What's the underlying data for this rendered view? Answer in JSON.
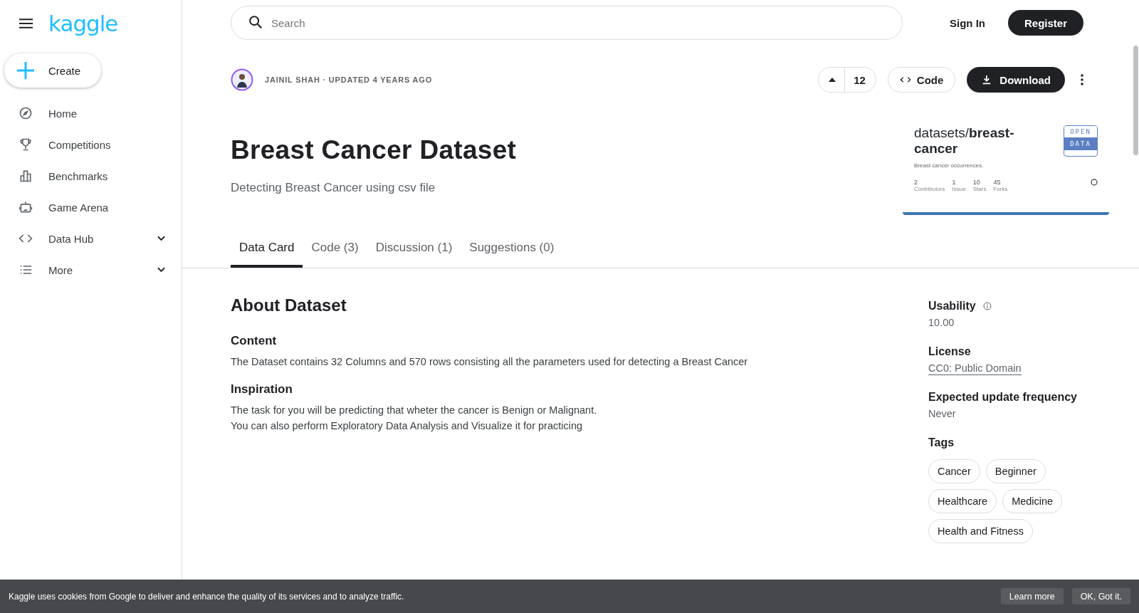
{
  "sidebar": {
    "logo": "kaggle",
    "create": "Create",
    "items": [
      {
        "label": "Home",
        "expandable": false
      },
      {
        "label": "Competitions",
        "expandable": false
      },
      {
        "label": "Benchmarks",
        "expandable": false
      },
      {
        "label": "Game Arena",
        "expandable": false
      },
      {
        "label": "Data Hub",
        "expandable": true
      },
      {
        "label": "More",
        "expandable": true
      }
    ]
  },
  "header": {
    "search": {
      "placeholder": "Search"
    },
    "sign_in": "Sign In",
    "register": "Register"
  },
  "dataset": {
    "byline": "JAINIL SHAH · UPDATED 4 YEARS AGO",
    "votes": "12",
    "code_button": "Code",
    "download_button": "Download",
    "title": "Breast Cancer Dataset",
    "subtitle": "Detecting Breast Cancer using csv file",
    "card": {
      "prefix": "datasets/",
      "name": "breast-cancer",
      "description": "Breast cancer occurrences.",
      "badge_top": "OPEN",
      "badge_bottom": "DATA",
      "stats": [
        {
          "count": "2",
          "label": "Contributors"
        },
        {
          "count": "1",
          "label": "Issue"
        },
        {
          "count": "10",
          "label": "Stars"
        },
        {
          "count": "45",
          "label": "Forks"
        }
      ]
    }
  },
  "tabs": [
    {
      "label": "Data Card",
      "selected": true
    },
    {
      "label": "Code (3)",
      "selected": false
    },
    {
      "label": "Discussion (1)",
      "selected": false
    },
    {
      "label": "Suggestions (0)",
      "selected": false
    }
  ],
  "about": {
    "heading": "About Dataset",
    "sections": [
      {
        "heading": "Content",
        "lines": [
          "The Dataset contains 32 Columns and 570 rows consisting all the parameters used for detecting a Breast Cancer"
        ]
      },
      {
        "heading": "Inspiration",
        "lines": [
          "The task for you will be predicting that wheter the cancer is Benign or Malignant.",
          "You can also perform Exploratory Data Analysis and Visualize it for practicing"
        ]
      }
    ]
  },
  "meta": {
    "usability_label": "Usability",
    "usability": "10.00",
    "license_label": "License",
    "license": "CC0: Public Domain",
    "frequency_label": "Expected update frequency",
    "frequency": "Never",
    "tags_label": "Tags",
    "tags": [
      "Cancer",
      "Beginner",
      "Healthcare",
      "Medicine",
      "Health and Fitness"
    ]
  },
  "cookie": {
    "text": "Kaggle uses cookies from Google to deliver and enhance the quality of its services and to analyze traffic.",
    "learn_more": "Learn more",
    "ok": "OK, Got it."
  }
}
